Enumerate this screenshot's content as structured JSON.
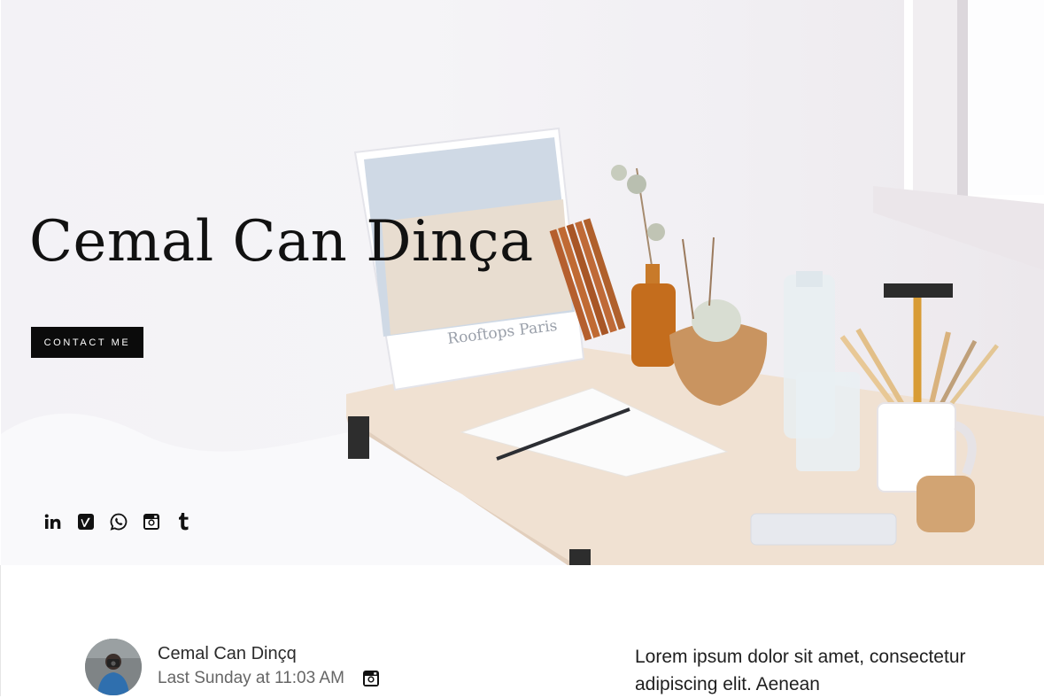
{
  "hero": {
    "title": "Cemal Can Dinça",
    "contact_button": "CONTACT ME",
    "book_title": "Rooftops Paris",
    "social_links": [
      {
        "icon": "linkedin-icon",
        "label": "in"
      },
      {
        "icon": "vimeo-icon",
        "label": "v"
      },
      {
        "icon": "whatsapp-icon",
        "label": ""
      },
      {
        "icon": "instagram-icon",
        "label": ""
      },
      {
        "icon": "tumblr-icon",
        "label": "t"
      }
    ]
  },
  "post": {
    "author": "Cemal Can Dinçq",
    "time": "Last Sunday at 11:03 AM",
    "text": "Lorem ipsum dolor sit amet, consectetur adipiscing elit. Aenean"
  },
  "colors": {
    "button": "#0b0b0b",
    "text": "#111111",
    "muted": "#666666"
  }
}
